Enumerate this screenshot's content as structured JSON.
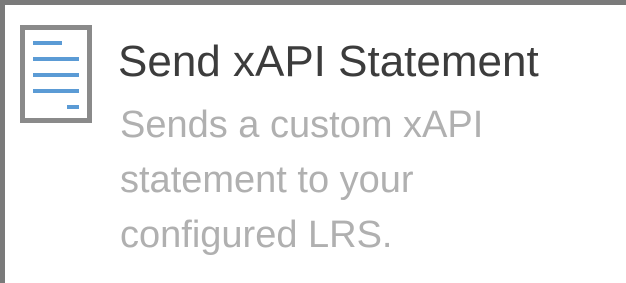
{
  "action": {
    "icon": "document-lines-icon",
    "title": "Send xAPI Statement",
    "description": "Sends a custom xAPI statement to your configured LRS."
  },
  "colors": {
    "border": "#7a7a7a",
    "icon_frame": "#8a8a8a",
    "icon_lines": "#5b9bd5",
    "title": "#3c3c3c",
    "description": "#b0b0b0"
  }
}
